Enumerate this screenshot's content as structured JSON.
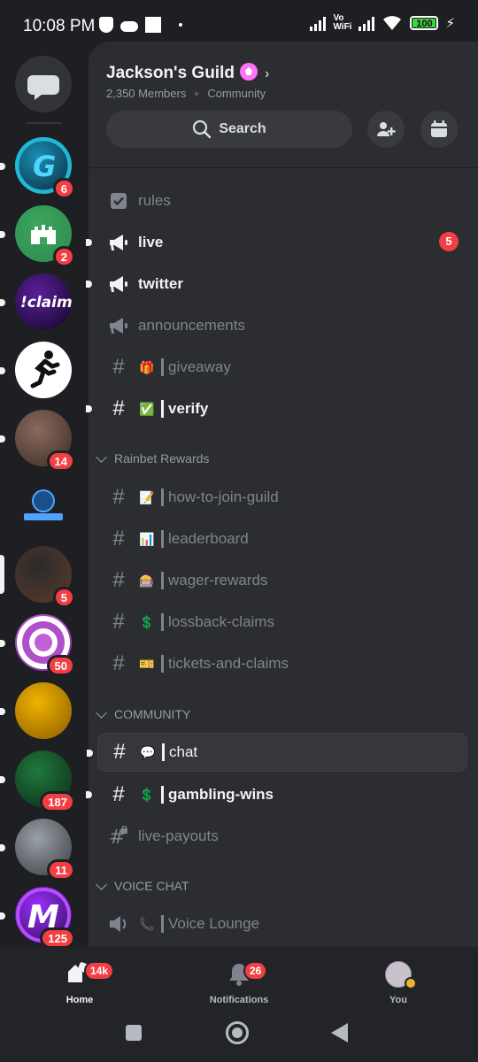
{
  "status_bar": {
    "time": "10:08 PM",
    "vowifi": "Vo WiFi",
    "battery": "100"
  },
  "rail": {
    "dm_icon": "chat-bubble-icon",
    "servers": [
      {
        "name": "server-g",
        "badge": "6",
        "colors": [
          "#1a8fb3",
          "#0b2030"
        ],
        "glyph": "G"
      },
      {
        "name": "server-castle",
        "badge": "2",
        "colors": [
          "#3ba55d",
          "#2f8a4c"
        ],
        "glyph": "castle"
      },
      {
        "name": "server-iclaim",
        "badge": "",
        "colors": [
          "#5a1f9e",
          "#12061f"
        ],
        "glyph": "!claim"
      },
      {
        "name": "server-runner",
        "badge": "",
        "colors": [
          "#ffffff",
          "#ffffff"
        ],
        "glyph": "runner"
      },
      {
        "name": "server-face",
        "badge": "14",
        "colors": [
          "#8a6a5c",
          "#3a2c28"
        ],
        "glyph": ""
      },
      {
        "name": "server-sunmeaw",
        "badge": "",
        "colors": [
          "#1e1f22",
          "#1e1f22"
        ],
        "glyph": "logo"
      },
      {
        "name": "server-jackson",
        "badge": "5",
        "colors": [
          "#2b2b2b",
          "#5a3a2a"
        ],
        "glyph": ""
      },
      {
        "name": "server-ring",
        "badge": "50",
        "colors": [
          "#c25fd8",
          "#7a2b9a"
        ],
        "glyph": "ring"
      },
      {
        "name": "server-gold",
        "badge": "",
        "colors": [
          "#f0b400",
          "#8a5a00"
        ],
        "glyph": ""
      },
      {
        "name": "server-green",
        "badge": "187",
        "colors": [
          "#1e7a3d",
          "#0e2a18"
        ],
        "glyph": ""
      },
      {
        "name": "server-guy",
        "badge": "11",
        "colors": [
          "#9aa0a8",
          "#3a3c40"
        ],
        "glyph": ""
      },
      {
        "name": "server-m",
        "badge": "125",
        "colors": [
          "#9b30ff",
          "#2a0a4a"
        ],
        "glyph": "M"
      }
    ]
  },
  "guild": {
    "name": "Jackson's Guild",
    "members": "2,350 Members",
    "type": "Community",
    "search_label": "Search"
  },
  "channels": {
    "top": [
      {
        "name": "rules",
        "icon": "rules-icon",
        "state": "read"
      },
      {
        "name": "live",
        "icon": "announcement-icon",
        "state": "unread",
        "badge": "5"
      },
      {
        "name": "twitter",
        "icon": "announcement-icon",
        "state": "unread"
      },
      {
        "name": "announcements",
        "icon": "announcement-icon",
        "state": "read"
      },
      {
        "name": "giveaway",
        "icon": "hash-icon",
        "emoji": "🎁",
        "state": "read"
      },
      {
        "name": "verify",
        "icon": "hash-icon",
        "emoji": "✅",
        "state": "unread"
      }
    ],
    "categories": [
      {
        "label": "Rainbet Rewards",
        "items": [
          {
            "name": "how-to-join-guild",
            "emoji": "📝"
          },
          {
            "name": "leaderboard",
            "emoji": "📊"
          },
          {
            "name": "wager-rewards",
            "emoji": "🎰"
          },
          {
            "name": "lossback-claims",
            "emoji": "💲"
          },
          {
            "name": "tickets-and-claims",
            "emoji": "🎫"
          }
        ]
      },
      {
        "label": "COMMUNITY",
        "items": [
          {
            "name": "chat",
            "emoji": "💬",
            "state": "selected"
          },
          {
            "name": "gambling-wins",
            "emoji": "💲",
            "state": "unread"
          },
          {
            "name": "live-payouts",
            "state": "locked"
          }
        ]
      },
      {
        "label": "VOICE CHAT",
        "items": [
          {
            "name": "Voice Lounge",
            "emoji": "📞",
            "state": "voice"
          }
        ]
      }
    ]
  },
  "bottom_nav": {
    "home": {
      "label": "Home",
      "badge": "14k"
    },
    "notifications": {
      "label": "Notifications",
      "badge": "26"
    },
    "you": {
      "label": "You"
    }
  },
  "colors": {
    "accent_red": "#f23f43",
    "panel": "#2b2d31",
    "rail": "#1e1f22",
    "boost_pink": "#ff73fa"
  }
}
